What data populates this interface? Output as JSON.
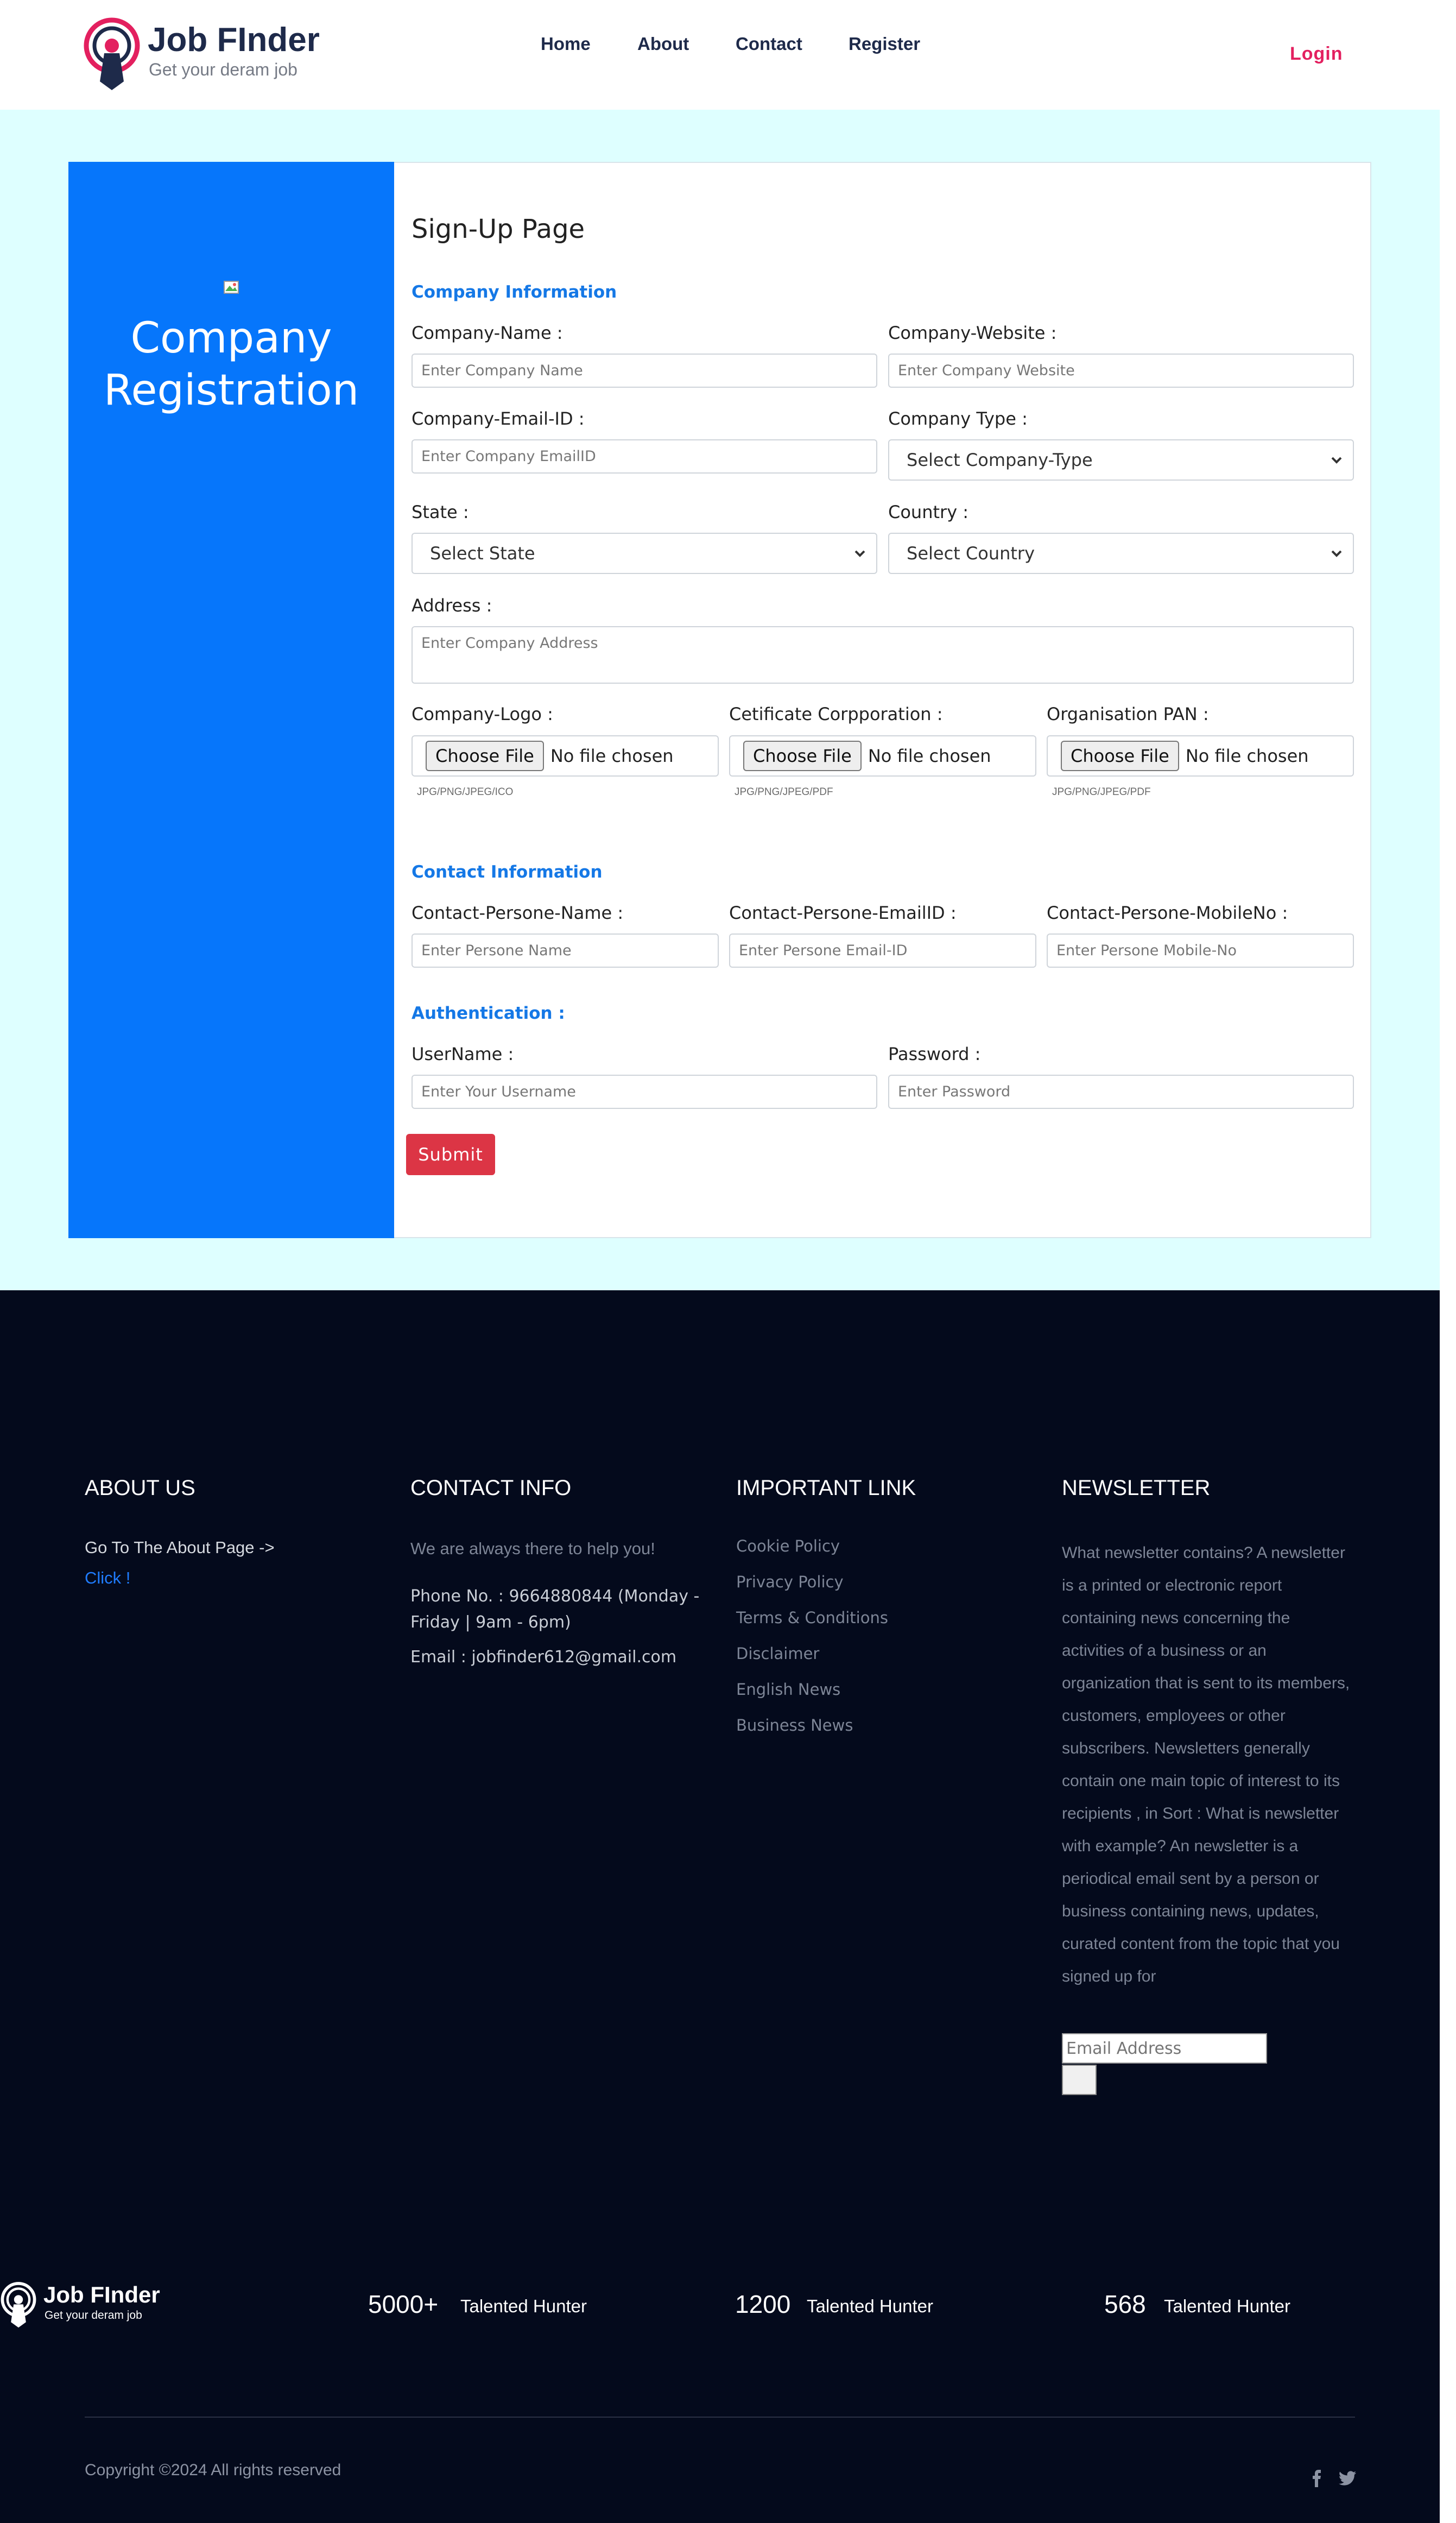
{
  "brand": {
    "name": "Job FInder",
    "tagline": "Get your deram job",
    "accent": "#e3205f",
    "primary": "#0676fb"
  },
  "nav": {
    "home": "Home",
    "about": "About",
    "contact": "Contact",
    "register": "Register",
    "login": "Login"
  },
  "side": {
    "title_line1": "Company",
    "title_line2": "Registration"
  },
  "form": {
    "title": "Sign-Up Page",
    "company_section": "Company Information",
    "company_name_label": "Company-Name :",
    "company_name_placeholder": "Enter Company Name",
    "company_website_label": "Company-Website :",
    "company_website_placeholder": "Enter Company Website",
    "company_email_label": "Company-Email-ID :",
    "company_email_placeholder": "Enter Company EmailID",
    "company_type_label": "Company Type :",
    "company_type_value": "Select Company-Type",
    "state_label": "State :",
    "state_value": "Select State",
    "country_label": "Country :",
    "country_value": "Select Country",
    "address_label": "Address :",
    "address_placeholder": "Enter Company Address",
    "logo_label": "Company-Logo :",
    "cert_label": "Cetificate Corpporation :",
    "pan_label": "Organisation PAN :",
    "choose_file": "Choose File",
    "no_file": "No file chosen",
    "logo_hint": "JPG/PNG/JPEG/ICO",
    "cert_hint": "JPG/PNG/JPEG/PDF",
    "pan_hint": "JPG/PNG/JPEG/PDF",
    "contact_section": "Contact Information",
    "person_name_label": "Contact-Persone-Name :",
    "person_name_placeholder": "Enter Persone Name",
    "person_email_label": "Contact-Persone-EmailID :",
    "person_email_placeholder": "Enter Persone Email-ID",
    "person_mobile_label": "Contact-Persone-MobileNo :",
    "person_mobile_placeholder": "Enter Persone Mobile-No",
    "auth_section": "Authentication :",
    "username_label": "UserName :",
    "username_placeholder": "Enter Your Username",
    "password_label": "Password :",
    "password_placeholder": "Enter Password",
    "submit": "Submit"
  },
  "footer": {
    "about_title": "ABOUT US",
    "about_text": "Go To The About Page ->",
    "about_link": "Click !",
    "contact_title": "CONTACT INFO",
    "contact_intro": "We are always there to help you!",
    "phone": "Phone No. : 9664880844 (Monday - Friday | 9am - 6pm)",
    "email": "Email : jobfinder612@gmail.com",
    "links_title": "IMPORTANT LINK",
    "links": [
      "Cookie Policy",
      "Privacy Policy",
      "Terms & Conditions",
      "Disclaimer",
      "English News",
      "Business News"
    ],
    "newsletter_title": "NEWSLETTER",
    "newsletter_text": "What newsletter contains? A newsletter is a printed or electronic report containing news concerning the activities of a business or an organization that is sent to its members, customers, employees or other subscribers. Newsletters generally contain one main topic of interest to its recipients , in Sort : What is newsletter with example? An newsletter is a periodical email sent by a person or business containing news, updates, curated content from the topic that you signed up for",
    "newsletter_placeholder": "Email Address",
    "stats": [
      {
        "num": "5000+",
        "label": "Talented Hunter"
      },
      {
        "num": "1200",
        "label": "Talented Hunter"
      },
      {
        "num": "568",
        "label": "Talented Hunter"
      }
    ],
    "copyright": "Copyright ©2024 All rights reserved"
  }
}
